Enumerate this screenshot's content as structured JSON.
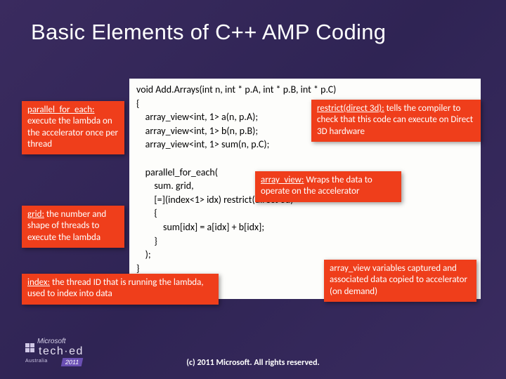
{
  "title": "Basic Elements of C++ AMP Coding",
  "code": "void Add.Arrays(int n, int * p.A, int * p.B, int * p.C)\n{\n    array_view<int, 1> a(n, p.A);\n    array_view<int, 1> b(n, p.B);\n    array_view<int, 1> sum(n, p.C);\n\n    parallel_for_each(\n        sum. grid,\n        [=](index<1> idx) restrict(direct 3d)\n        {\n            sum[idx] = a[idx] + b[idx];\n        }\n    );\n}",
  "callouts": {
    "parallel": {
      "head": "parallel_for_each:",
      "body": " execute the lambda on the accelerator once per thread"
    },
    "grid": {
      "head": "grid:",
      "body": " the number and shape of threads to execute the lambda"
    },
    "restrict": {
      "head": "restrict(direct 3d):",
      "body": " tells the compiler to check that this code can execute on Direct 3D hardware"
    },
    "arrview": {
      "head": "array_view:",
      "body": " Wraps the data to operate on the accelerator"
    },
    "capture": {
      "head": "",
      "body": "array_view variables captured and associated data copied to accelerator (on demand)"
    },
    "index": {
      "head": "index:",
      "body": " the thread ID that is running the lambda, used to index into data"
    }
  },
  "footer": {
    "brand_small": "Microsoft",
    "brand_big": "tech·ed",
    "region": "Australia",
    "year": "2011",
    "copyright": "(c) 2011 Microsoft. All rights reserved."
  }
}
